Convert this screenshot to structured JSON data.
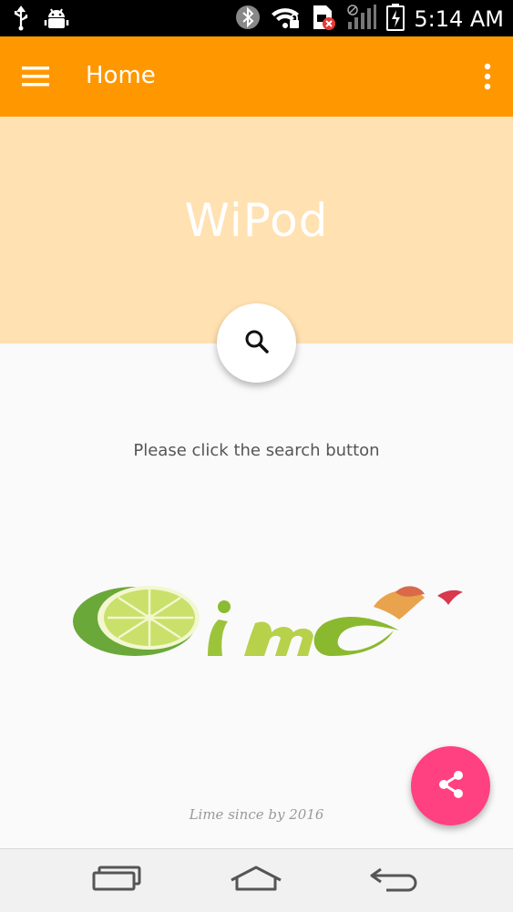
{
  "status_bar": {
    "time": "5:14 AM",
    "icons": [
      "usb-icon",
      "android-debug-icon",
      "bluetooth-icon",
      "wifi-lock-icon",
      "sim-error-icon",
      "signal-icon",
      "battery-charging-icon"
    ]
  },
  "app_bar": {
    "title": "Home",
    "menu_icon": "menu-icon",
    "overflow_icon": "more-vert-icon",
    "color": "#ff9800"
  },
  "hero": {
    "title": "WiPod",
    "color": "#ffe1b2"
  },
  "search": {
    "icon": "search-icon",
    "hint": "Please click the search button"
  },
  "logo": {
    "text": "Lime"
  },
  "footer": {
    "text": "Lime since by 2016"
  },
  "share": {
    "icon": "share-icon",
    "color": "#ff4081"
  },
  "nav_bar": {
    "buttons": [
      "recent-apps-icon",
      "home-icon",
      "back-icon"
    ]
  }
}
